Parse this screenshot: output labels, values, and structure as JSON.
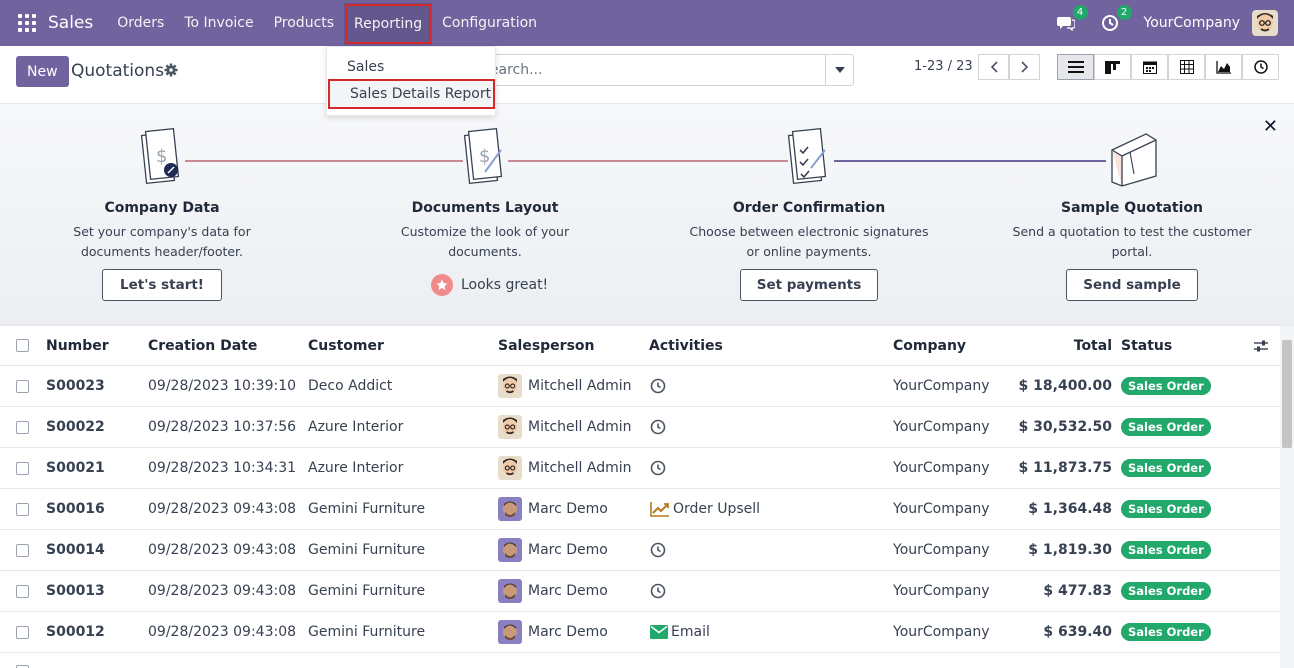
{
  "navbar": {
    "brand": "Sales",
    "menu": [
      "Orders",
      "To Invoice",
      "Products",
      "Reporting",
      "Configuration"
    ],
    "messages_count": "4",
    "activities_count": "2",
    "company": "YourCompany"
  },
  "control": {
    "new_label": "New",
    "title": "Quotations",
    "search_placeholder": "Search...",
    "pager": "1-23 / 23"
  },
  "reporting_dropdown": {
    "items": [
      "Sales",
      "Sales Details Report"
    ]
  },
  "onboarding": {
    "steps": [
      {
        "title": "Company Data",
        "desc": "Set your company's data for documents header/footer.",
        "button": "Let's start!"
      },
      {
        "title": "Documents Layout",
        "desc": "Customize the look of your documents.",
        "done_label": "Looks great!"
      },
      {
        "title": "Order Confirmation",
        "desc": "Choose between electronic signatures or online payments.",
        "button": "Set payments"
      },
      {
        "title": "Sample Quotation",
        "desc": "Send a quotation to test the customer portal.",
        "button": "Send sample"
      }
    ]
  },
  "table": {
    "columns": [
      "Number",
      "Creation Date",
      "Customer",
      "Salesperson",
      "Activities",
      "Company",
      "Total",
      "Status"
    ],
    "rows": [
      {
        "number": "S00023",
        "date": "09/28/2023 10:39:10",
        "customer": "Deco Addict",
        "salesperson": "Mitchell Admin",
        "activity": "",
        "activity_icon": "clock",
        "company": "YourCompany",
        "total": "$ 18,400.00",
        "status": "Sales Order"
      },
      {
        "number": "S00022",
        "date": "09/28/2023 10:37:56",
        "customer": "Azure Interior",
        "salesperson": "Mitchell Admin",
        "activity": "",
        "activity_icon": "clock",
        "company": "YourCompany",
        "total": "$ 30,532.50",
        "status": "Sales Order"
      },
      {
        "number": "S00021",
        "date": "09/28/2023 10:34:31",
        "customer": "Azure Interior",
        "salesperson": "Mitchell Admin",
        "activity": "",
        "activity_icon": "clock",
        "company": "YourCompany",
        "total": "$ 11,873.75",
        "status": "Sales Order"
      },
      {
        "number": "S00016",
        "date": "09/28/2023 09:43:08",
        "customer": "Gemini Furniture",
        "salesperson": "Marc Demo",
        "activity": "Order Upsell",
        "activity_icon": "upsell",
        "company": "YourCompany",
        "total": "$ 1,364.48",
        "status": "Sales Order"
      },
      {
        "number": "S00014",
        "date": "09/28/2023 09:43:08",
        "customer": "Gemini Furniture",
        "salesperson": "Marc Demo",
        "activity": "",
        "activity_icon": "clock",
        "company": "YourCompany",
        "total": "$ 1,819.30",
        "status": "Sales Order"
      },
      {
        "number": "S00013",
        "date": "09/28/2023 09:43:08",
        "customer": "Gemini Furniture",
        "salesperson": "Marc Demo",
        "activity": "",
        "activity_icon": "clock",
        "company": "YourCompany",
        "total": "$ 477.83",
        "status": "Sales Order"
      },
      {
        "number": "S00012",
        "date": "09/28/2023 09:43:08",
        "customer": "Gemini Furniture",
        "salesperson": "Marc Demo",
        "activity": "Email",
        "activity_icon": "email",
        "company": "YourCompany",
        "total": "$ 639.40",
        "status": "Sales Order"
      }
    ]
  },
  "colors": {
    "brand": "#71639e",
    "status_green": "#21a86a",
    "highlight_red": "#d62828"
  }
}
